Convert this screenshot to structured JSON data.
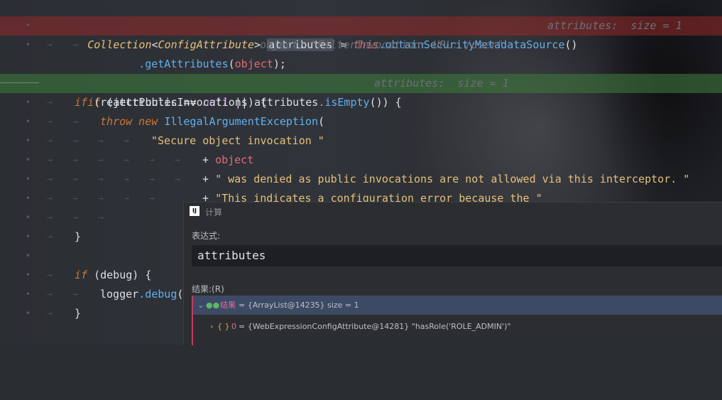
{
  "code": {
    "line1": {
      "type": "Collection",
      "lt": "<",
      "generic": "ConfigAttribute",
      "gt": ">",
      "var": "attributes",
      "eq": " = ",
      "this": "this",
      "call": ".obtainSecurityMetadataSource",
      "parens": "()",
      "hint": "attributes:  size = 1"
    },
    "line2": {
      "call": ".getAttributes",
      "open": "(",
      "arg": "object",
      "close": ");",
      "hint": "object: \"FilterInvocation: URL: /user\""
    },
    "line3": {
      "kw": "if",
      "open": " (",
      "var": "attributes",
      "op": " == ",
      "nul": "null",
      "or": " || ",
      "var2": "attributes",
      "call": ".isEmpty",
      "close": "()) {",
      "hint": "attributes:  size = 1"
    },
    "line4": {
      "kw": "if",
      "rest": " (rejectPublicInvocations) {"
    },
    "line5": {
      "kw1": "throw",
      "kw2": " new ",
      "cls": "IllegalArgumentException",
      "open": "("
    },
    "line6": {
      "str": "\"Secure object invocation \""
    },
    "line7": {
      "plus": "+ ",
      "param": "object"
    },
    "line8": {
      "plus": "+ ",
      "str": "\" was denied as public invocations are not allowed via this interceptor. \""
    },
    "line9": {
      "plus": "+ ",
      "str": "\"This indicates a configuration error because the \""
    },
    "line10": {
      "text": "}"
    },
    "line11": {
      "kw": "if",
      "rest": " (debug) {"
    },
    "line12": {
      "obj": "logger",
      "call": ".debug",
      "open": "("
    },
    "line13": {
      "text": "}"
    }
  },
  "dialog": {
    "icon_text": "IJ",
    "title": "计算",
    "expression_label": "表达式:",
    "expression_value": "attributes",
    "result_label": "结果:(R)",
    "result_row": {
      "icon": "glasses-icon",
      "label": "结果",
      "value": " = {ArrayList@14235}  size = 1"
    },
    "child_row": {
      "icon": "braces-icon",
      "index": "0",
      "value": " = {WebExpressionConfigAttribute@14281} \"hasRole('ROLE_ADMIN')\""
    }
  },
  "colors": {
    "breakpoint_line": "#962828",
    "current_line": "#3c783c",
    "selected_result_row": "#3d4a66",
    "accent_bar": "#c63a62"
  }
}
